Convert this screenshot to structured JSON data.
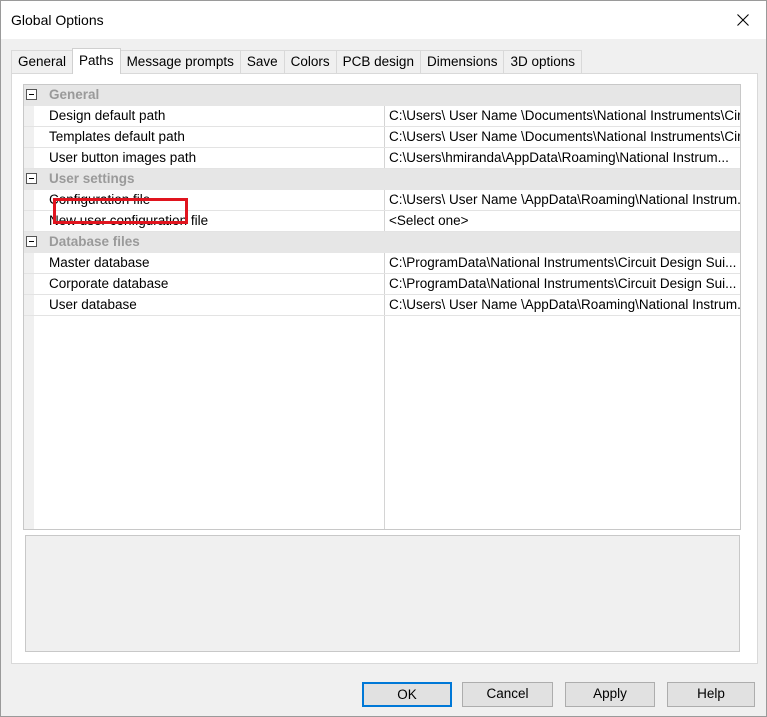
{
  "window": {
    "title": "Global Options"
  },
  "tabs": [
    {
      "label": "General"
    },
    {
      "label": "Paths",
      "active": true
    },
    {
      "label": "Message prompts"
    },
    {
      "label": "Save"
    },
    {
      "label": "Colors"
    },
    {
      "label": "PCB design"
    },
    {
      "label": "Dimensions"
    },
    {
      "label": "3D options"
    }
  ],
  "grid": {
    "categories": [
      {
        "label": "General",
        "items": [
          {
            "name": "Design default path",
            "value": "C:\\Users\\ User Name \\Documents\\National Instruments\\Cir..."
          },
          {
            "name": "Templates default path",
            "value": "C:\\Users\\ User Name \\Documents\\National Instruments\\Cir..."
          },
          {
            "name": "User button images path",
            "value": "C:\\Users\\hmiranda\\AppData\\Roaming\\National Instrum..."
          }
        ]
      },
      {
        "label": "User settings",
        "items": [
          {
            "name": "Configuration file",
            "value": "C:\\Users\\ User Name \\AppData\\Roaming\\National Instrum..."
          },
          {
            "name": "New user configuration file",
            "value": "<Select one>"
          }
        ]
      },
      {
        "label": "Database files",
        "items": [
          {
            "name": "Master database",
            "value": "C:\\ProgramData\\National Instruments\\Circuit Design Sui..."
          },
          {
            "name": "Corporate database",
            "value": "C:\\ProgramData\\National Instruments\\Circuit Design Sui..."
          },
          {
            "name": "User database",
            "value": "C:\\Users\\ User Name \\AppData\\Roaming\\National Instrum..."
          }
        ]
      }
    ]
  },
  "buttons": {
    "ok": "OK",
    "cancel": "Cancel",
    "apply": "Apply",
    "help": "Help"
  },
  "colors": {
    "highlight": "#e0141e",
    "default_button_border": "#0078d7",
    "category_text": "#9a9a9a"
  }
}
